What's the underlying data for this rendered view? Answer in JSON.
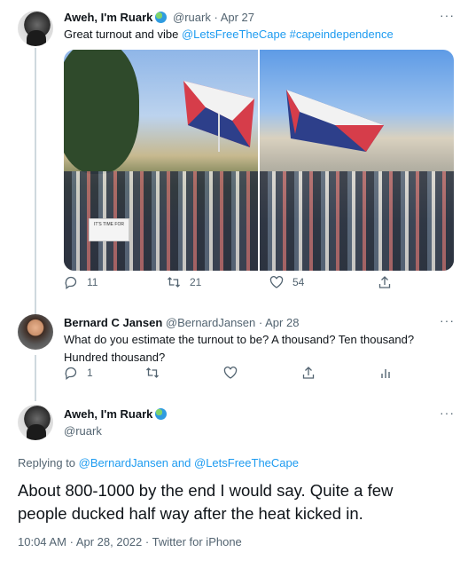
{
  "tweet1": {
    "name": "Aweh, I'm Ruark",
    "handle": "@ruark",
    "date": "Apr 27",
    "text": "Great turnout and vibe",
    "mention": "@LetsFreeTheCape",
    "hashtag": "#capeindependence",
    "reply_count": "11",
    "retweet_count": "21",
    "like_count": "54",
    "flag_sign_text": "IT'S TIME FOR"
  },
  "tweet2": {
    "name": "Bernard C Jansen",
    "handle": "@BernardJansen",
    "date": "Apr 28",
    "text_line1": "What do you estimate the turnout to be? A thousand? Ten thousand?",
    "text_line2": "Hundred thousand?",
    "reply_count": "1"
  },
  "tweet3": {
    "name": "Aweh, I'm Ruark",
    "handle": "@ruark",
    "replying_prefix": "Replying to",
    "replying_user1": "@BernardJansen",
    "replying_and": "and",
    "replying_user2": "@LetsFreeTheCape",
    "text_line1": "About 800-1000 by the end I would say. Quite a few",
    "text_line2": "people ducked half way after the heat kicked in.",
    "time": "10:04 AM",
    "date": "Apr 28, 2022",
    "source": "Twitter for iPhone"
  },
  "separator": "·",
  "more": "···",
  "colors": {
    "link": "#1d9bf0",
    "muted": "#536471",
    "line": "#cfd9de"
  },
  "icons": [
    "reply-icon",
    "retweet-icon",
    "like-icon",
    "share-icon",
    "analytics-icon",
    "more-icon",
    "globe-emoji-icon"
  ]
}
